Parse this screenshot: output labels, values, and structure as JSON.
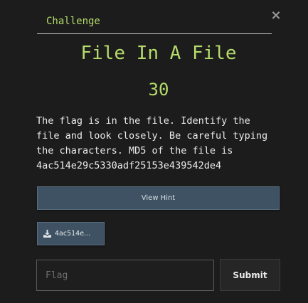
{
  "modal": {
    "tab_label": "Challenge",
    "close_icon": "close-icon",
    "close_glyph": "×"
  },
  "challenge": {
    "title": "File In A File",
    "value": "30",
    "description": "The flag is in the file. Identify the\nfile and look closely. Be careful typing\nthe characters. MD5 of the file is\n4ac514e29c5330adf25153e439542de4"
  },
  "buttons": {
    "hint_label": "View Hint",
    "file_label": "4ac514e...",
    "file_icon": "download-icon",
    "submit_label": "Submit"
  },
  "form": {
    "flag_placeholder": "Flag",
    "flag_value": ""
  },
  "colors": {
    "accent": "#b5dc6a",
    "background": "#1c1c1c",
    "button": "#3e5263"
  }
}
